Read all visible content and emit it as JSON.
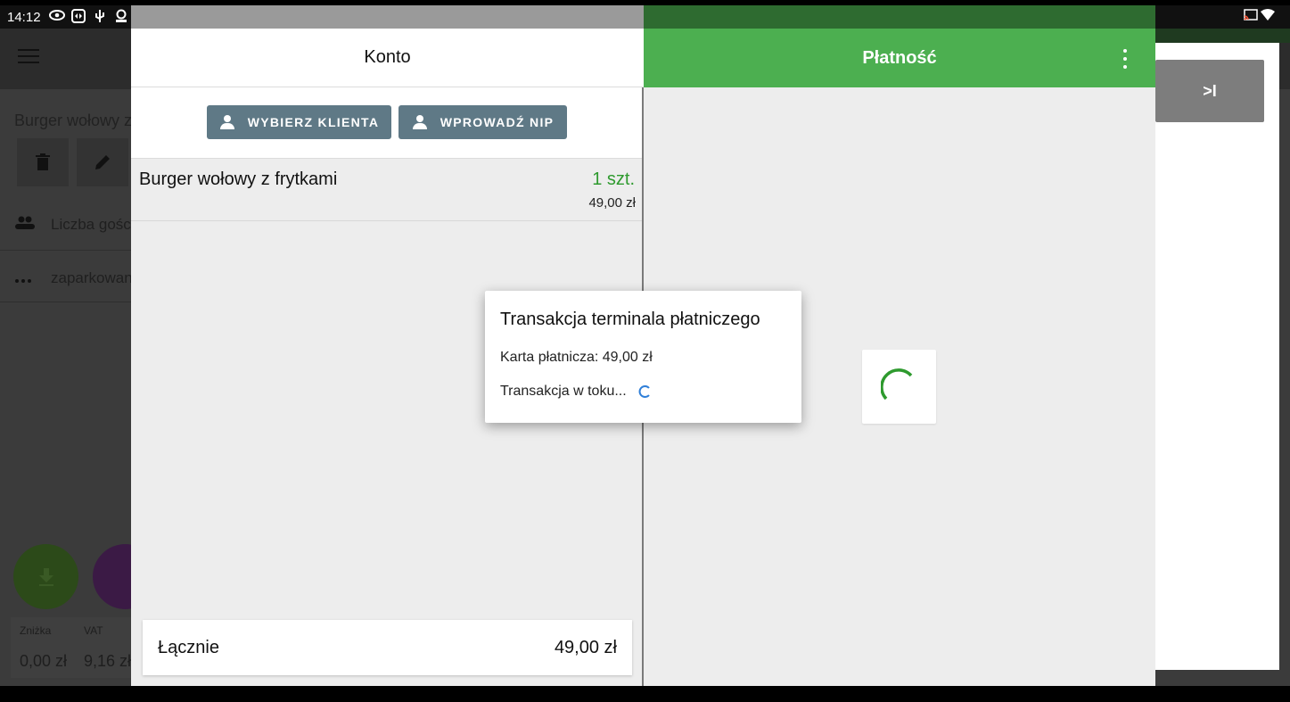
{
  "statusbar": {
    "time": "14:12",
    "icons": [
      "eye-icon",
      "teamviewer-icon",
      "usb-icon",
      "account-icon",
      "dot-icon",
      "cast-icon",
      "wifi-icon"
    ]
  },
  "background_app": {
    "product_title": "Burger wołowy z",
    "guests_label": "Liczba gośc",
    "parked_label": "zaparkowan",
    "discount_label": "Zniżka",
    "discount_value": "0,00 zł",
    "vat_label": "VAT",
    "vat_value": "9,16 zł",
    "skip_label": ">I"
  },
  "account_panel": {
    "title": "Konto",
    "select_client_label": "WYBIERZ KLIENTA",
    "enter_nip_label": "WPROWADŹ NIP",
    "items": [
      {
        "name": "Burger wołowy z frytkami",
        "qty": "1 szt.",
        "price": "49,00 zł"
      }
    ],
    "total_label": "Łącznie",
    "total_value": "49,00 zł"
  },
  "payment_panel": {
    "title": "Płatność",
    "header_color": "#4caf50"
  },
  "dialog": {
    "title": "Transakcja terminala płatniczego",
    "card_line": "Karta płatnicza: 49,00 zł",
    "status_line": "Transakcja w toku..."
  },
  "colors": {
    "accent_green": "#4caf50",
    "qty_green": "#2e9a2e",
    "client_button": "#5f7986"
  }
}
